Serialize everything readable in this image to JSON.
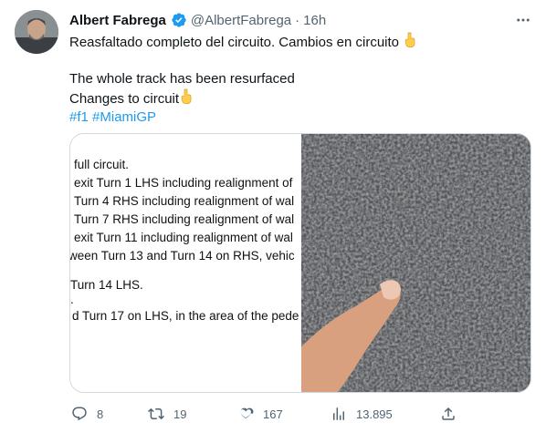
{
  "tweet": {
    "author_name": "Albert Fabrega",
    "handle": "@AlbertFabrega",
    "separator": "·",
    "time": "16h",
    "text_line1": "Reasfaltado completo del circuito. Cambios en circuito",
    "text_line2": "The whole track has been resurfaced",
    "text_line3": "Changes to circuit",
    "hashtags": [
      "#f1",
      "#MiamiGP"
    ]
  },
  "media": {
    "document_lines": [
      "full circuit.",
      "exit Turn 1 LHS including realignment of",
      "Turn 4 RHS including realignment of wal",
      "Turn 7 RHS including realignment of wal",
      "exit Turn 11 including realignment of wal",
      "ween Turn 13 and Turn 14 on RHS, vehic",
      "Turn 14 LHS.",
      ".",
      "d Turn 17 on LHS, in the area of the pede"
    ]
  },
  "actions": {
    "replies": "8",
    "retweets": "19",
    "likes": "167",
    "views": "13.895"
  },
  "colors": {
    "accent": "#1d9bf0",
    "secondary_text": "#536471",
    "primary_text": "#0f1419"
  },
  "icons": [
    "verified-badge-icon",
    "more-options-icon",
    "point-down-emoji",
    "reply-icon",
    "retweet-icon",
    "like-icon",
    "views-icon",
    "share-icon"
  ]
}
